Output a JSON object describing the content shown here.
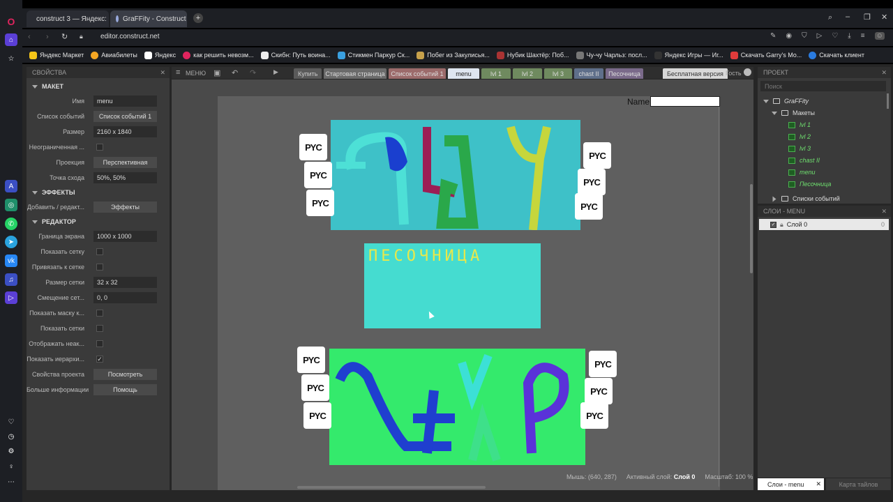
{
  "browser": {
    "tabs": [
      {
        "label": "construct 3 — Яндекс: на",
        "active": false
      },
      {
        "label": "GraFFity - Construct 3",
        "active": true
      }
    ],
    "url": "editor.construct.net",
    "bookmarks": [
      "Яндекс Маркет",
      "Авиабилеты",
      "Яндекс",
      "как решить невозм...",
      "Скибн: Путь воина...",
      "Стикмен Паркур Ск...",
      "Побег из Закулисья...",
      "Нубик Шахтёр: Поб...",
      "Чу-чу Чарльз: посл...",
      "Яндекс Игры — Иг...",
      "Скачать Garry's Mo...",
      "Скачать клиент"
    ]
  },
  "properties": {
    "title": "СВОЙСТВА",
    "sections": {
      "layout": "МАКЕТ",
      "effects": "ЭФФЕКТЫ",
      "editor": "РЕДАКТОР"
    },
    "layout_rows": [
      {
        "label": "Имя",
        "value": "menu",
        "kind": "field"
      },
      {
        "label": "Список событий",
        "value": "Список событий 1",
        "kind": "button"
      },
      {
        "label": "Размер",
        "value": "2160 x 1840",
        "kind": "field"
      },
      {
        "label": "Неограниченная ...",
        "value": "",
        "kind": "check"
      },
      {
        "label": "Проекция",
        "value": "Перспективная",
        "kind": "button"
      },
      {
        "label": "Точка схода",
        "value": "50%,  50%",
        "kind": "field"
      }
    ],
    "effects_rows": [
      {
        "label": "Добавить / редакт...",
        "value": "Эффекты",
        "kind": "button"
      }
    ],
    "editor_rows": [
      {
        "label": "Граница экрана",
        "value": "1000 x 1000",
        "kind": "field"
      },
      {
        "label": "Показать сетку",
        "value": "",
        "kind": "check"
      },
      {
        "label": "Привязать к сетке",
        "value": "",
        "kind": "check"
      },
      {
        "label": "Размер сетки",
        "value": "32 x 32",
        "kind": "field"
      },
      {
        "label": "Смещение сет...",
        "value": "0,  0",
        "kind": "field"
      },
      {
        "label": "Показать маску к...",
        "value": "",
        "kind": "check"
      },
      {
        "label": "Показать сетки",
        "value": "",
        "kind": "check"
      },
      {
        "label": "Отображать неак...",
        "value": "",
        "kind": "check"
      },
      {
        "label": "Показать иерархи...",
        "value": "✓",
        "kind": "check"
      },
      {
        "label": "Свойства проекта",
        "value": "Посмотреть",
        "kind": "button"
      },
      {
        "label": "Больше информации",
        "value": "Помощь",
        "kind": "button"
      }
    ]
  },
  "toolbar": {
    "menu": "МЕНЮ",
    "buy": "Купить",
    "free_version": "Бесплатная версия",
    "guest": "Гость"
  },
  "editor_tabs": [
    {
      "label": "Стартовая страница",
      "color": "#6b6b6b"
    },
    {
      "label": "Список событий 1",
      "color": "#9c6b6b"
    },
    {
      "label": "menu",
      "color": "#dfe6f0"
    },
    {
      "label": "lvl 1",
      "color": "#6f8a5f"
    },
    {
      "label": "lvl 2",
      "color": "#6f8a5f"
    },
    {
      "label": "lvl 3",
      "color": "#6f8a5f"
    },
    {
      "label": "chast II",
      "color": "#5f6f8a"
    },
    {
      "label": "Песочница",
      "color": "#7a6a8a"
    }
  ],
  "canvas": {
    "name_label": "Name",
    "pyc_text": "PYC",
    "play_art": "PLAY",
    "sandbox_art": "ПЕСОЧНИЦА",
    "status": {
      "mouse": "Мышь: (640, 287)",
      "active_layer_label": "Активный слой:",
      "active_layer": "Слой 0",
      "zoom": "Масштаб: 100 %"
    }
  },
  "project": {
    "title": "ПРОЕКТ",
    "search_placeholder": "Поиск",
    "root": "GraFFity",
    "layouts_folder": "Макеты",
    "layouts": [
      "lvl 1",
      "lvl 2",
      "lvl 3",
      "chast II",
      "menu",
      "Песочница"
    ],
    "event_sheets_folder": "Списки событий"
  },
  "layers": {
    "title": "СЛОИ - MENU",
    "items": [
      {
        "name": "Слой 0",
        "count": "0"
      }
    ],
    "bottom_tabs": [
      "Слои - menu",
      "Карта тайлов"
    ]
  }
}
